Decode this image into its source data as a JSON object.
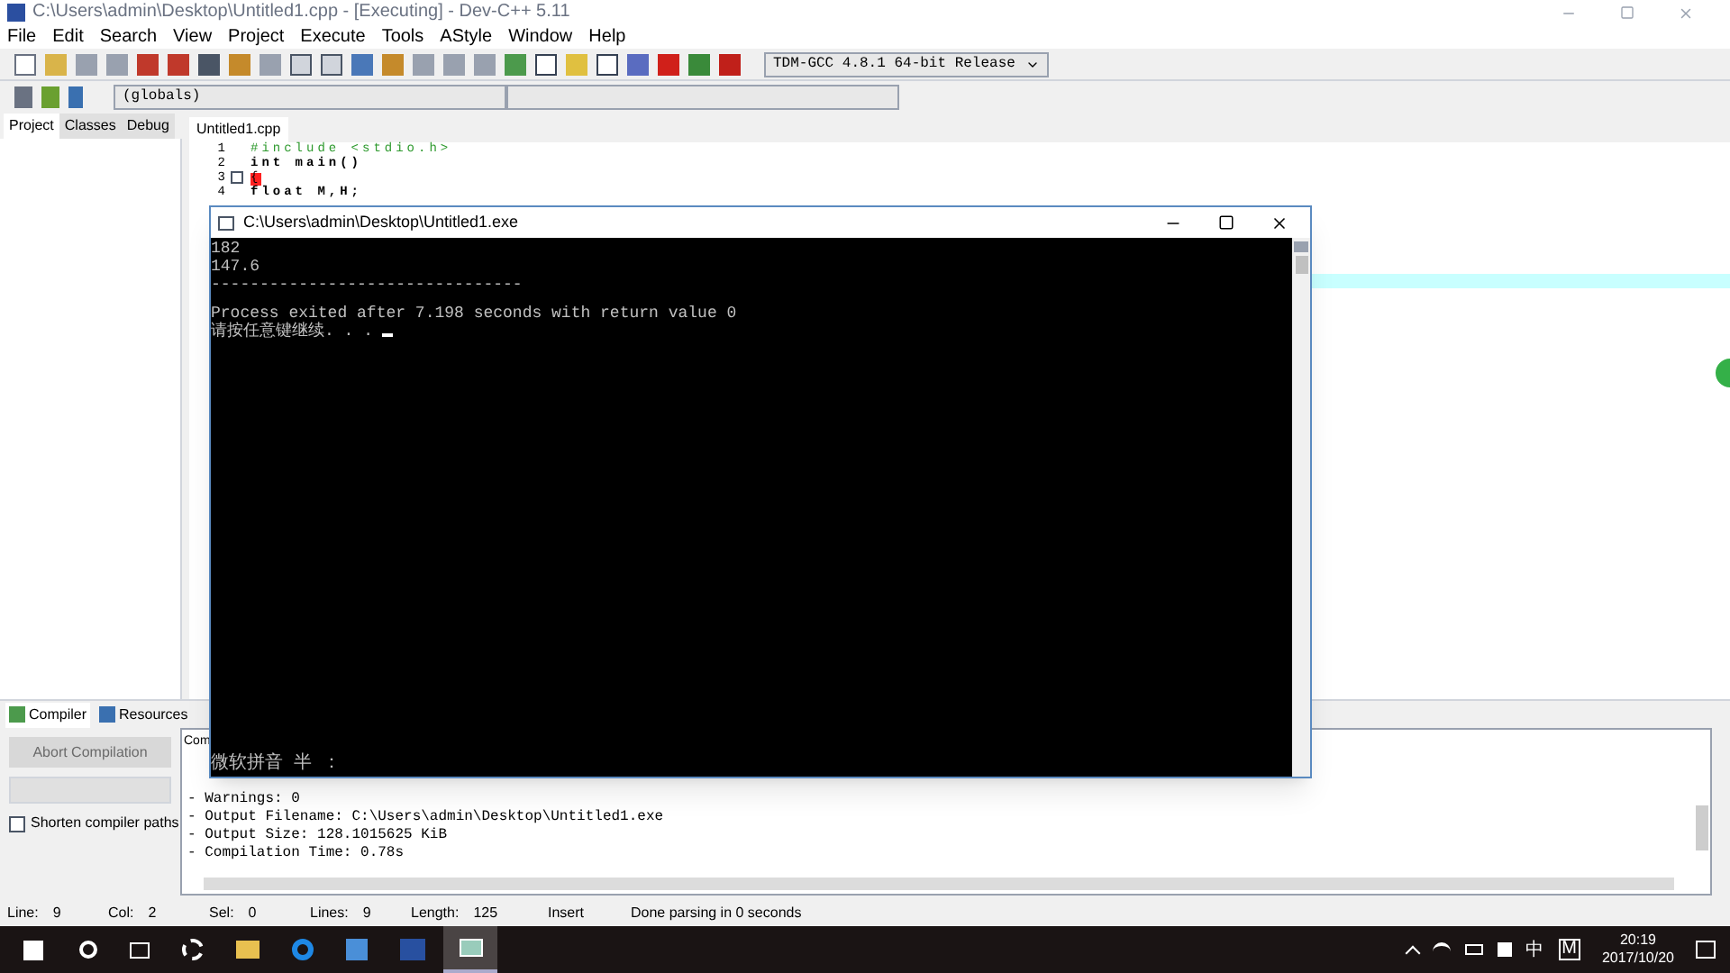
{
  "window": {
    "title": "C:\\Users\\admin\\Desktop\\Untitled1.cpp - [Executing] - Dev-C++ 5.11"
  },
  "menu": [
    "File",
    "Edit",
    "Search",
    "View",
    "Project",
    "Execute",
    "Tools",
    "AStyle",
    "Window",
    "Help"
  ],
  "compiler_select": {
    "value": "TDM-GCC 4.8.1 64-bit Release"
  },
  "scope_select": {
    "value": "(globals)"
  },
  "left_tabs": [
    {
      "label": "Project",
      "selected": true
    },
    {
      "label": "Classes",
      "selected": false
    },
    {
      "label": "Debug",
      "selected": false
    }
  ],
  "editor": {
    "tab": "Untitled1.cpp",
    "lines": [
      {
        "number": "1",
        "kind": "directive",
        "text": "#include <stdio.h>",
        "fold": false
      },
      {
        "number": "2",
        "kind": "keyword",
        "text": "int main()",
        "fold": false
      },
      {
        "number": "3",
        "kind": "brace",
        "text": "{",
        "fold": true
      },
      {
        "number": "4",
        "kind": "keyword",
        "text": "float M,H;",
        "fold": false
      }
    ]
  },
  "console": {
    "title": "C:\\Users\\admin\\Desktop\\Untitled1.exe",
    "lines": [
      "182",
      "147.6",
      "--------------------------------",
      "Process exited after 7.198 seconds with return value 0",
      "请按任意键继续. . ."
    ],
    "ime": "微软拼音 半 ："
  },
  "bottom_tabs": [
    {
      "label": "Compiler",
      "selected": true
    },
    {
      "label": "Resources",
      "selected": false
    }
  ],
  "compiler_panel": {
    "abort_button": {
      "label": "Abort Compilation",
      "disabled": true
    },
    "shorten_paths": {
      "label": "Shorten compiler paths",
      "checked": false
    },
    "log_header": "Com",
    "log": [
      "- Warnings: 0",
      "- Output Filename: C:\\Users\\admin\\Desktop\\Untitled1.exe",
      "- Output Size: 128.1015625 KiB",
      "- Compilation Time: 0.78s"
    ]
  },
  "status_bar": [
    {
      "label": "Line:",
      "value": "9"
    },
    {
      "label": "Col:",
      "value": "2"
    },
    {
      "label": "Sel:",
      "value": "0"
    },
    {
      "label": "Lines:",
      "value": "9"
    },
    {
      "label": "Length:",
      "value": "125"
    },
    {
      "value": "Insert"
    },
    {
      "value": "Done parsing in 0 seconds"
    }
  ],
  "taskbar": {
    "ime_lang": "中",
    "ime_mode": "M",
    "time": "20:19",
    "date": "2017/10/20"
  }
}
